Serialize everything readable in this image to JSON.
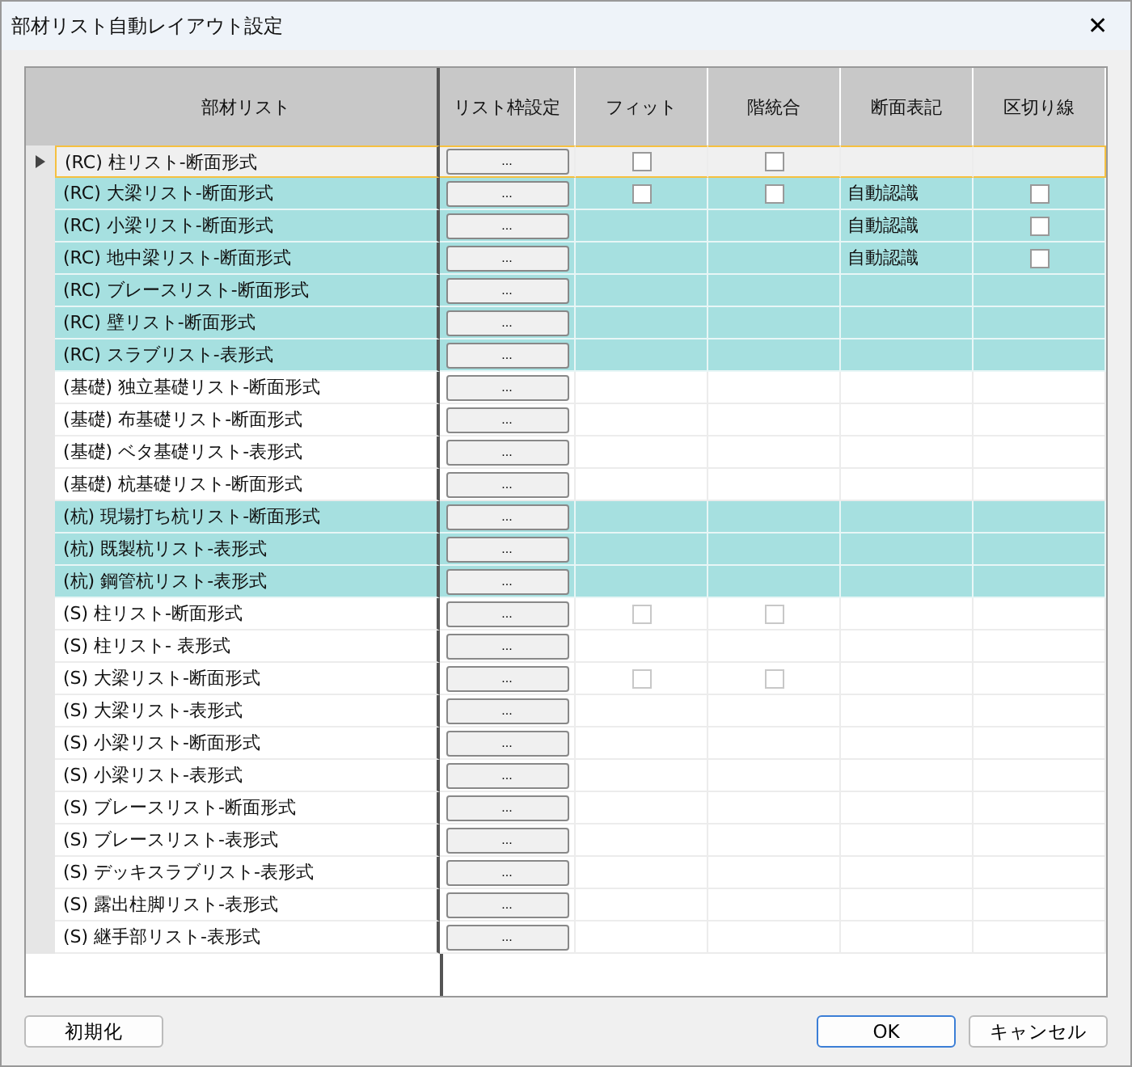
{
  "window": {
    "title": "部材リスト自動レイアウト設定",
    "close": "✕"
  },
  "table": {
    "columns": [
      "部材リスト",
      "リスト枠設定",
      "フィット",
      "階統合",
      "断面表記",
      "区切り線"
    ],
    "rows": [
      {
        "name": "(RC) 柱リスト-断面形式",
        "highlighted": false,
        "current": true,
        "button": "...",
        "fit": {
          "checked": false,
          "disabled": false
        },
        "merge": {
          "checked": false,
          "disabled": false
        }
      },
      {
        "name": "(RC) 大梁リスト-断面形式",
        "highlighted": true,
        "current": false,
        "button": "...",
        "fit": {
          "checked": false,
          "disabled": false
        },
        "merge": {
          "checked": false,
          "disabled": false
        },
        "section": "自動認識",
        "divider": {
          "checked": false,
          "disabled": false
        }
      },
      {
        "name": "(RC) 小梁リスト-断面形式",
        "highlighted": true,
        "current": false,
        "button": "...",
        "section": "自動認識",
        "divider": {
          "checked": false,
          "disabled": false
        }
      },
      {
        "name": "(RC) 地中梁リスト-断面形式",
        "highlighted": true,
        "current": false,
        "button": "...",
        "section": "自動認識",
        "divider": {
          "checked": false,
          "disabled": false
        }
      },
      {
        "name": "(RC) ブレースリスト-断面形式",
        "highlighted": true,
        "current": false,
        "button": "..."
      },
      {
        "name": "(RC) 壁リスト-断面形式",
        "highlighted": true,
        "current": false,
        "button": "..."
      },
      {
        "name": "(RC) スラブリスト-表形式",
        "highlighted": true,
        "current": false,
        "button": "..."
      },
      {
        "name": "(基礎) 独立基礎リスト-断面形式",
        "highlighted": false,
        "current": false,
        "button": "..."
      },
      {
        "name": "(基礎) 布基礎リスト-断面形式",
        "highlighted": false,
        "current": false,
        "button": "..."
      },
      {
        "name": "(基礎) ベタ基礎リスト-表形式",
        "highlighted": false,
        "current": false,
        "button": "..."
      },
      {
        "name": "(基礎) 杭基礎リスト-断面形式",
        "highlighted": false,
        "current": false,
        "button": "..."
      },
      {
        "name": "(杭) 現場打ち杭リスト-断面形式",
        "highlighted": true,
        "current": false,
        "button": "..."
      },
      {
        "name": "(杭) 既製杭リスト-表形式",
        "highlighted": true,
        "current": false,
        "button": "..."
      },
      {
        "name": "(杭) 鋼管杭リスト-表形式",
        "highlighted": true,
        "current": false,
        "button": "..."
      },
      {
        "name": "(S) 柱リスト-断面形式",
        "highlighted": false,
        "current": false,
        "button": "...",
        "fit": {
          "checked": false,
          "disabled": true
        },
        "merge": {
          "checked": false,
          "disabled": true
        }
      },
      {
        "name": "(S) 柱リスト- 表形式",
        "highlighted": false,
        "current": false,
        "button": "..."
      },
      {
        "name": "(S) 大梁リスト-断面形式",
        "highlighted": false,
        "current": false,
        "button": "...",
        "fit": {
          "checked": false,
          "disabled": true
        },
        "merge": {
          "checked": false,
          "disabled": true
        }
      },
      {
        "name": "(S) 大梁リスト-表形式",
        "highlighted": false,
        "current": false,
        "button": "..."
      },
      {
        "name": "(S) 小梁リスト-断面形式",
        "highlighted": false,
        "current": false,
        "button": "..."
      },
      {
        "name": "(S) 小梁リスト-表形式",
        "highlighted": false,
        "current": false,
        "button": "..."
      },
      {
        "name": "(S) ブレースリスト-断面形式",
        "highlighted": false,
        "current": false,
        "button": "..."
      },
      {
        "name": "(S) ブレースリスト-表形式",
        "highlighted": false,
        "current": false,
        "button": "..."
      },
      {
        "name": "(S) デッキスラブリスト-表形式",
        "highlighted": false,
        "current": false,
        "button": "..."
      },
      {
        "name": "(S) 露出柱脚リスト-表形式",
        "highlighted": false,
        "current": false,
        "button": "..."
      },
      {
        "name": "(S) 継手部リスト-表形式",
        "highlighted": false,
        "current": false,
        "button": "..."
      }
    ]
  },
  "buttons": {
    "reset": "初期化",
    "ok": "OK",
    "cancel": "キャンセル"
  }
}
